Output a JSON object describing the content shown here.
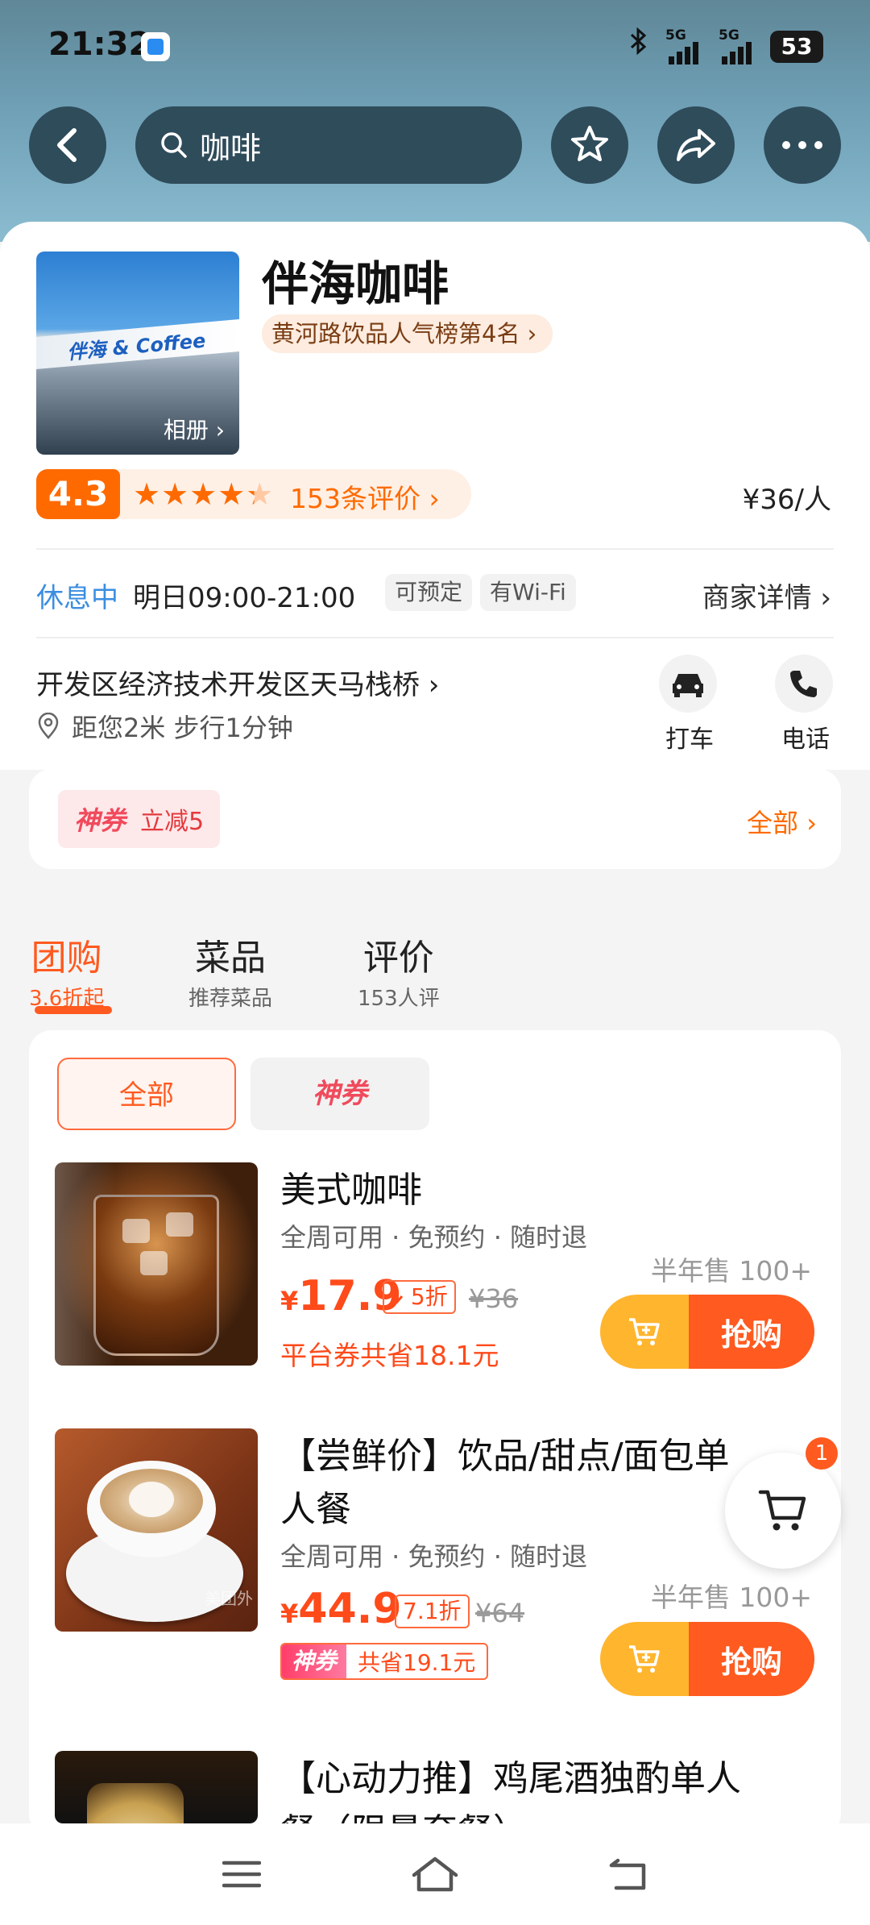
{
  "status_bar": {
    "time": "21:32",
    "battery": "53",
    "network": "5G"
  },
  "search": {
    "query": "咖啡"
  },
  "shop": {
    "name": "伴海咖啡",
    "rank": "黄河路饮品人气榜第4名",
    "photo_sign": "伴海 & Coffee",
    "album_label": "相册",
    "score": "4.3",
    "stars": "★★★★★",
    "star_fill": 0.86,
    "reviews": "153条评价",
    "price": "¥36/人",
    "status": "休息中",
    "hours": "明日09:00-21:00",
    "tags": [
      "可预定",
      "有Wi-Fi"
    ],
    "detail_link": "商家详情",
    "address": "开发区经济技术开发区天马栈桥",
    "distance": "距您2米 步行1分钟",
    "actions": {
      "taxi": "打车",
      "phone": "电话"
    }
  },
  "coupon": {
    "brand": "神券",
    "offer": "立减5",
    "all": "全部"
  },
  "tabs": [
    {
      "title": "团购",
      "sub": "3.6折起"
    },
    {
      "title": "菜品",
      "sub": "推荐菜品"
    },
    {
      "title": "评价",
      "sub": "153人评"
    }
  ],
  "filters": {
    "all": "全部",
    "shen": "神券"
  },
  "deals": [
    {
      "title": "美式咖啡",
      "sub": "全周可用 · 免预约 · 随时退",
      "currency": "¥",
      "price": "17.9",
      "discount": "5折",
      "orig": "¥36",
      "sold": "半年售 100+",
      "save": "平台券共省18.1元",
      "buy": "抢购"
    },
    {
      "title_line1": "【尝鲜价】饮品/甜点/面包单",
      "title_line2": "人餐",
      "sub": "全周可用 · 免预约 · 随时退",
      "currency": "¥",
      "price": "44.9",
      "discount": "7.1折",
      "orig": "¥64",
      "sold": "半年售 100+",
      "combo_brand": "神券",
      "combo_save": "共省19.1元",
      "buy": "抢购",
      "watermark": "美团外"
    },
    {
      "title_line1": "【心动力推】鸡尾酒独酌单人",
      "title_line2": "餐（限量套餐）"
    }
  ],
  "float_cart": {
    "count": "1"
  },
  "colors": {
    "accent": "#ff5a1f",
    "blue": "#3b8ee0",
    "header": "#6fa0b6"
  }
}
